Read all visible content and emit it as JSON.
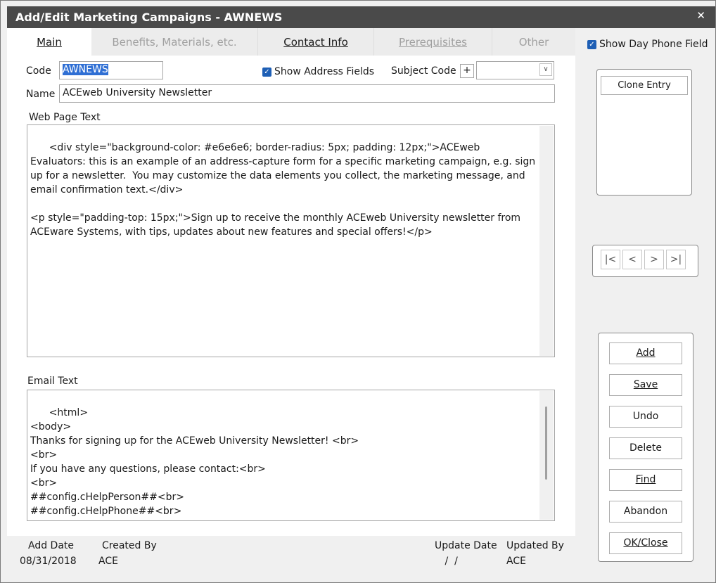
{
  "window": {
    "title": "Add/Edit Marketing Campaigns - AWNEWS",
    "close_label": "✕"
  },
  "tabs": [
    {
      "label": "Main"
    },
    {
      "label": "Benefits, Materials, etc."
    },
    {
      "label": "Contact Info"
    },
    {
      "label": "Prerequisites"
    },
    {
      "label": "Other"
    }
  ],
  "form": {
    "code_label": "Code",
    "code_value": "AWNEWS",
    "show_address_label": "Show Address Fields",
    "show_address_checked": true,
    "subject_code_label": "Subject Code",
    "subject_plus_label": "+",
    "subject_code_value": "",
    "name_label": "Name",
    "name_value": "ACEweb University Newsletter",
    "web_page_text_label": "Web Page Text",
    "web_page_text": "<div style=\"background-color: #e6e6e6; border-radius: 5px; padding: 12px;\">ACEweb Evaluators: this is an example of an address-capture form for a specific marketing campaign, e.g. sign up for a newsletter.  You may customize the data elements you collect, the marketing message, and email confirmation text.</div>\n\n<p style=\"padding-top: 15px;\">Sign up to receive the monthly ACEweb University newsletter from ACEware Systems, with tips, updates about new features and special offers!</p>",
    "email_text_label": "Email Text",
    "email_text": "<html>\n<body>\nThanks for signing up for the ACEweb University Newsletter! <br>\n<br>\nIf you have any questions, please contact:<br>\n<br>\n##config.cHelpPerson##<br>\n##config.cHelpPhone##<br>\n##config.cHelpEmail##<br>"
  },
  "footer": {
    "add_date_label": "Add Date",
    "add_date_value": "08/31/2018",
    "created_by_label": "Created By",
    "created_by_value": "ACE",
    "update_date_label": "Update Date",
    "update_date_value": " /  /",
    "updated_by_label": "Updated By",
    "updated_by_value": "ACE"
  },
  "sidebar": {
    "show_day_phone_label": "Show Day Phone Field",
    "show_day_phone_checked": true,
    "clone_entry_label": "Clone Entry",
    "nav": {
      "first": "|<",
      "prev": "<",
      "next": ">",
      "last": ">|"
    },
    "buttons": {
      "add": "Add",
      "save": "Save",
      "undo": "Undo",
      "delete": "Delete",
      "find": "Find",
      "abandon": "Abandon",
      "ok_close": "OK/Close"
    }
  },
  "colors": {
    "titlebar": "#4a4a4a",
    "selection": "#2f6fd4",
    "checkbox": "#1e5fb5"
  }
}
